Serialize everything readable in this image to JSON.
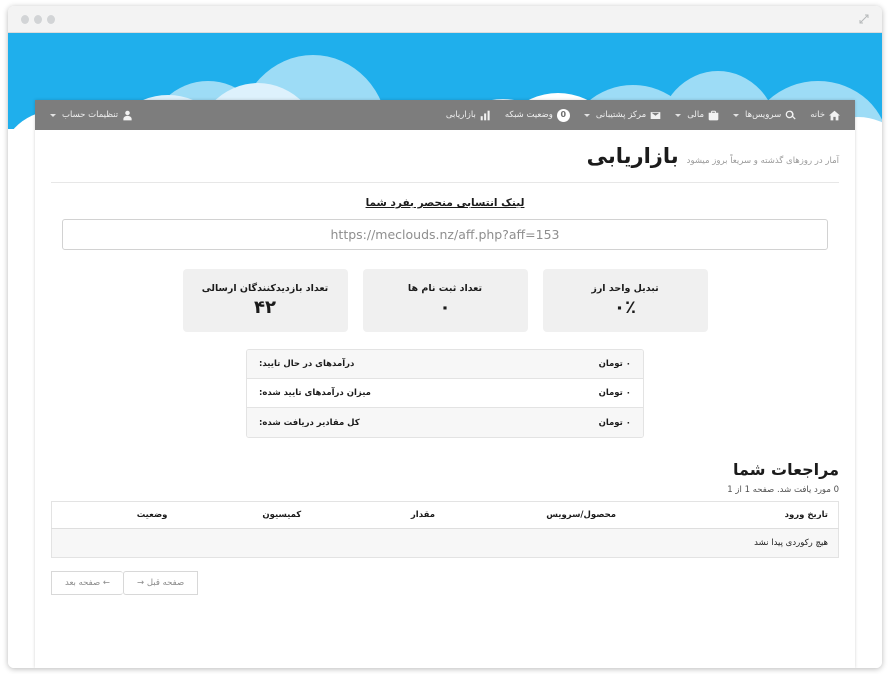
{
  "window": {
    "expand_icon": "expand-icon",
    "dots": [
      "close",
      "minimize",
      "maximize"
    ]
  },
  "banner": {
    "sky_color": "#1fafec",
    "cloud_back": "#9ddcf6",
    "cloud_mid": "#ddf1fc",
    "cloud_front": "#ffffff"
  },
  "navbar": {
    "background": "#7d7d7d",
    "left_items": [
      {
        "label": "بازاریابی",
        "icon": "bar-chart-icon",
        "badge": null,
        "caret": false
      },
      {
        "label": "وضعیت شبکه",
        "icon": "status-badge-icon",
        "badge": "0",
        "caret": false
      },
      {
        "label": "مرکز پشتیبانی",
        "icon": "envelope-icon",
        "badge": null,
        "caret": true
      },
      {
        "label": "مالی",
        "icon": "briefcase-icon",
        "badge": null,
        "caret": true
      },
      {
        "label": "سرویس‌ها",
        "icon": "search-icon",
        "badge": null,
        "caret": true
      },
      {
        "label": "خانه",
        "icon": "home-icon",
        "badge": null,
        "caret": false
      }
    ],
    "account_item": {
      "label": "تنظیمات حساب",
      "icon": "user-icon",
      "caret": true
    }
  },
  "header": {
    "title": "بازاریابی",
    "subtitle": "آمار در روزهای گذشته و سریعاً بروز میشود"
  },
  "affiliate": {
    "heading": "لینک انتسابی منحصر بفرد شما",
    "url": "https://meclouds.nz/aff.php?aff=153",
    "placeholder": "https://meclouds.nz/aff.php?aff=153"
  },
  "stats": [
    {
      "label": "تبدیل واحد ارز",
      "value": "۰٪"
    },
    {
      "label": "تعداد ثبت نام ها",
      "value": "۰"
    },
    {
      "label": "تعداد بازدیدکنندگان ارسالی",
      "value": "۴۲"
    }
  ],
  "earnings": [
    {
      "label": "درآمدهای در حال تایید:",
      "amount": "۰ تومان"
    },
    {
      "label": "میزان درآمدهای تایید شده:",
      "amount": "۰ تومان"
    },
    {
      "label": "کل مقادیر دریافت شده:",
      "amount": "۰ تومان"
    }
  ],
  "referrals": {
    "title": "مراجعات شما",
    "count_text": "0 مورد یافت شد. صفحه 1 از 1",
    "columns": [
      "تاریخ ورود",
      "محصول/سرویس",
      "مقدار",
      "کمیسیون",
      "وضعیت"
    ],
    "empty_text": "هیچ رکوردی پیدا نشد",
    "pager": {
      "next": "صفحه بعد ←",
      "prev": "→ صفحه قبل"
    }
  }
}
